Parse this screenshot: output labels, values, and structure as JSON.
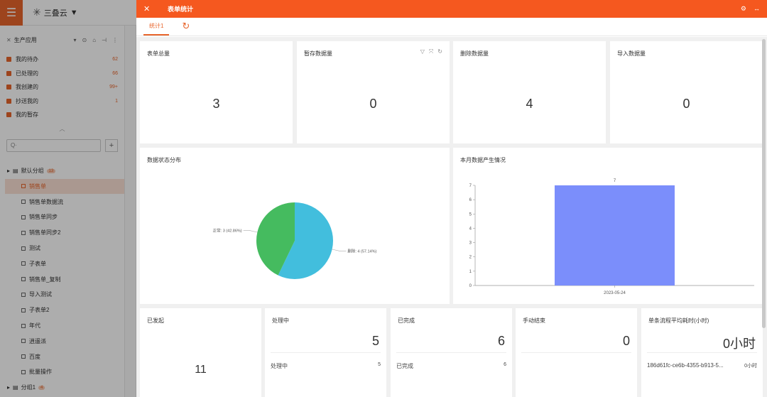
{
  "app": {
    "name": "三叠云"
  },
  "sidebar": {
    "app_title": "生产应用",
    "quick": [
      {
        "label": "我的待办",
        "count": "62"
      },
      {
        "label": "已处理的",
        "count": "66"
      },
      {
        "label": "我创建的",
        "count": "99+"
      },
      {
        "label": "抄送我的",
        "count": "1"
      },
      {
        "label": "我的暂存",
        "count": ""
      }
    ],
    "search_placeholder": "Q·",
    "groups": [
      {
        "label": "默认分组",
        "badge": "13"
      },
      {
        "label": "分组1",
        "badge": "4"
      }
    ],
    "items": [
      "销售单",
      "销售单数据流",
      "销售单同步",
      "销售单同步2",
      "测试",
      "子表单",
      "销售单_复制",
      "导入测试",
      "子表单2",
      "年代",
      "逍遥派",
      "百度",
      "批量操作"
    ]
  },
  "drawer": {
    "title": "表单统计",
    "tab": "统计1",
    "stats": [
      {
        "label": "表单总量",
        "value": "3"
      },
      {
        "label": "暂存数据量",
        "value": "0"
      },
      {
        "label": "删除数据量",
        "value": "4"
      },
      {
        "label": "导入数据量",
        "value": "0"
      }
    ],
    "pie_title": "数据状态分布",
    "bar_title": "本月数据产生情况",
    "bottom": {
      "started": {
        "label": "已发起",
        "value": "11"
      },
      "processing": {
        "label": "处理中",
        "value": "5",
        "row_label": "处理中",
        "row_value": "5"
      },
      "done": {
        "label": "已完成",
        "value": "6",
        "row_label": "已完成",
        "row_value": "6"
      },
      "manual_end": {
        "label": "手动结束",
        "value": "0"
      },
      "avg": {
        "label": "单条流程平均耗时(小时)",
        "value": "0小时",
        "row_label": "186d61fc-ce6b-4355-b913-5...",
        "row_value": "0小时"
      }
    }
  },
  "colors": {
    "accent": "#f5581f",
    "pie_green": "#45bb5f",
    "pie_blue": "#42bedd",
    "bar": "#7b8efb"
  },
  "chart_data": [
    {
      "type": "pie",
      "title": "数据状态分布",
      "slices": [
        {
          "name": "删除",
          "value": 4,
          "label": "删除: 4 (57.14%)"
        },
        {
          "name": "正常",
          "value": 3,
          "label": "正常: 3 (42.86%)"
        }
      ]
    },
    {
      "type": "bar",
      "title": "本月数据产生情况",
      "categories": [
        "2023-05-24"
      ],
      "values": [
        7
      ],
      "ylim": [
        0,
        7
      ],
      "yticks": [
        "0",
        "1",
        "2",
        "3",
        "4",
        "5",
        "6",
        "7"
      ]
    }
  ]
}
